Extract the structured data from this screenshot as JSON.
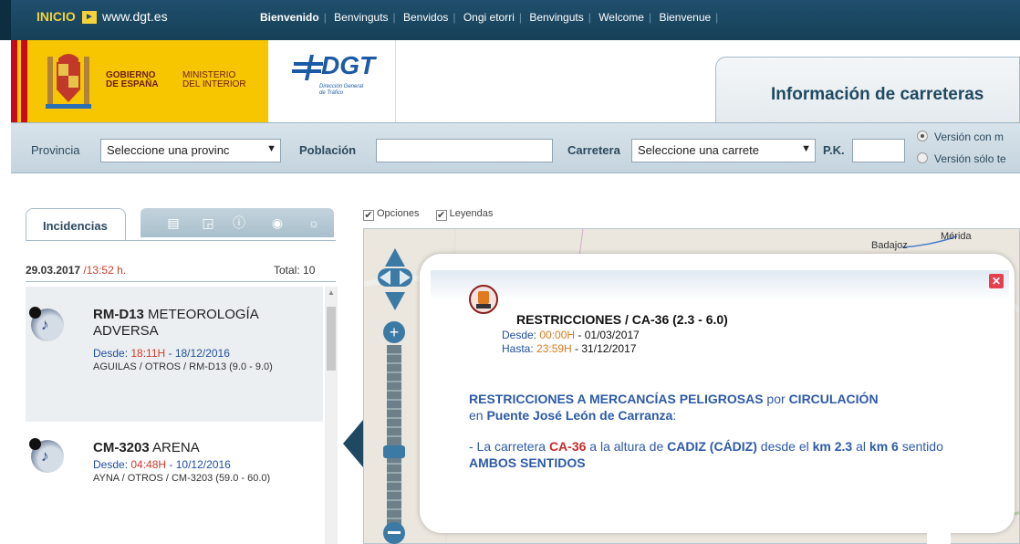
{
  "topbar": {
    "inicio": "INICIO",
    "site": "www.dgt.es",
    "languages": [
      "Bienvenido",
      "Benvinguts",
      "Benvidos",
      "Ongi etorri",
      "Benvinguts",
      "Welcome",
      "Bienvenue"
    ]
  },
  "header": {
    "gobierno": "GOBIERNO\nDE ESPAÑA",
    "ministerio": "MINISTERIO\nDEL INTERIOR",
    "dgt_logo": "DGT",
    "dgt_sub": "Dirección General\nde Tráfico",
    "section_title": "Información de carreteras"
  },
  "filters": {
    "provincia_label": "Provincia",
    "provincia_value": "Seleccione una provinc",
    "poblacion_label": "Población",
    "carretera_label": "Carretera",
    "carretera_value": "Seleccione una carrete",
    "pk_label": "P.K.",
    "version_a": "Versión con m",
    "version_b": "Versión sólo te"
  },
  "panel": {
    "tab_label": "Incidencias",
    "date": "29.03.2017",
    "time": "/13:52 h.",
    "total": "Total: 10"
  },
  "incidents": [
    {
      "code": "RM-D13",
      "type": "METEOROLOGÍA ADVERSA",
      "desde_label": "Desde: ",
      "desde_time": "18:11H",
      "desde_date": " - 18/12/2016",
      "location": "AGUILAS / OTROS / RM-D13 (9.0 - 9.0)"
    },
    {
      "code": "CM-3203",
      "type": "ARENA",
      "desde_label": "Desde: ",
      "desde_time": "04:48H",
      "desde_date": " - 10/12/2016",
      "location": "AYNA / OTROS / CM-3203 (59.0 - 60.0)"
    }
  ],
  "map": {
    "opt_opciones": "Opciones",
    "opt_leyendas": "Leyendas",
    "city1": "Badajoz",
    "city2": "Mérida"
  },
  "popup": {
    "title": "RESTRICCIONES / CA-36 (2.3 - 6.0)",
    "desde_label": "Desde: ",
    "desde_time": "00:00H",
    "desde_date": " - 01/03/2017",
    "hasta_label": "Hasta: ",
    "hasta_time": "23:59H",
    "hasta_date": " - 31/12/2017",
    "desc1_bold": "RESTRICCIONES A MERCANCÍAS PELIGROSAS",
    "desc1_mid": " por ",
    "desc1_bold2": "CIRCULACIÓN",
    "desc1_line2_pre": "en ",
    "desc1_place": "Puente José León de Carranza",
    "desc1_end": ":",
    "desc2_pre": "- La carretera ",
    "desc2_road": "CA-36",
    "desc2_mid": " a la altura de ",
    "desc2_city": "CADIZ (CÁDIZ)",
    "desc2_mid2": " desde el ",
    "desc2_km1": "km 2.3",
    "desc2_mid3": " al ",
    "desc2_km2": "km 6",
    "desc2_mid4": " sentido ",
    "desc2_dir": "AMBOS SENTIDOS"
  },
  "colors": {
    "accent": "#1f4962",
    "alert_red": "#d23a2a",
    "link_blue": "#2d5aa6"
  }
}
